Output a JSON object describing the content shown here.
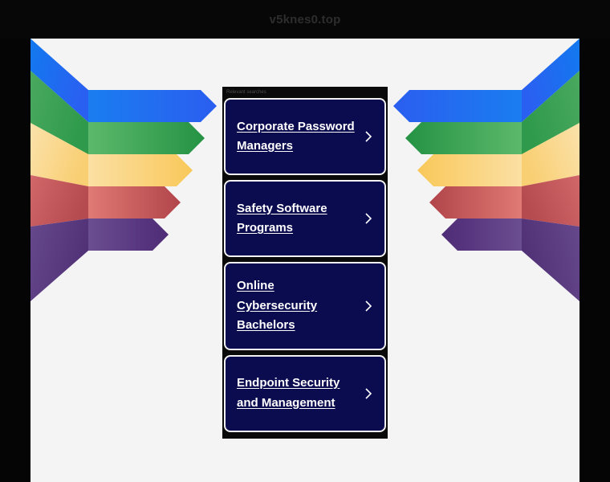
{
  "window": {
    "domain_title": "v5knes0.top",
    "background_color": "#050505",
    "sheet_color": "#f4f4f5"
  },
  "ads": {
    "header_label": "Relevant searches",
    "card_background": "#0b0b50",
    "card_border": "#f2f2f2",
    "link_color": "#ffffff",
    "chevron_icon": "chevron-right-icon",
    "items": [
      {
        "label": "Corporate Password Managers"
      },
      {
        "label": "Safety Software Programs"
      },
      {
        "label": "Online Cybersecurity Bachelors"
      },
      {
        "label": "Endpoint Security and Management"
      }
    ]
  },
  "decoration": {
    "name": "arrow-bands-graphic",
    "bands": [
      {
        "name": "blue",
        "color_light": "#1a7df0",
        "color_dark": "#2b5ef0",
        "wing": "#1f6ef2"
      },
      {
        "name": "green",
        "color_light": "#5cb96b",
        "color_dark": "#259244",
        "wing": "#45a85c"
      },
      {
        "name": "amber",
        "color_light": "#fbdfa0",
        "color_dark": "#f9c martial",
        "wing": "#fbd98a"
      },
      {
        "name": "red",
        "color_light": "#e07a74",
        "color_dark": "#b1454a",
        "wing": "#cd6263"
      },
      {
        "name": "purple",
        "color_light": "#6b4d91",
        "color_dark": "#4e2b76",
        "wing": "#5b3f85"
      }
    ]
  }
}
